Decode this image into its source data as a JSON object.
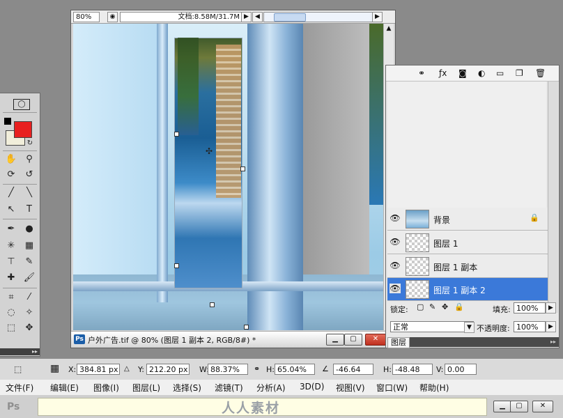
{
  "document": {
    "zoom": "80%",
    "doc_info": "文档:8.58M/31.7M",
    "title": "户外广告.tif @ 80% (图层 1 副本 2, RGB/8#) *",
    "ps_badge": "Ps"
  },
  "layers_panel": {
    "tab_label": "图层",
    "blend_mode": "正常",
    "opacity_label": "不透明度:",
    "opacity_value": "100%",
    "lock_label": "锁定:",
    "fill_label": "填充:",
    "fill_value": "100%",
    "layers": [
      {
        "name": "图层 1 副本 2",
        "active": true,
        "type": "transparent"
      },
      {
        "name": "图层 1 副本",
        "active": false,
        "type": "transparent"
      },
      {
        "name": "图层 1",
        "active": false,
        "type": "transparent"
      },
      {
        "name": "背景",
        "active": false,
        "type": "background",
        "locked": true
      }
    ]
  },
  "options_bar": {
    "x_label": "X:",
    "x_value": "384.81 px",
    "y_label": "Y:",
    "y_value": "212.20 px",
    "w_label": "W:",
    "w_value": "88.37%",
    "h_label": "H:",
    "h_value": "65.04%",
    "angle_value": "-46.64",
    "h_skew_label": "H:",
    "h_skew_value": "-48.48",
    "v_skew_label": "V:",
    "v_skew_value": "0.00"
  },
  "menu": [
    "文件(F)",
    "编辑(E)",
    "图像(I)",
    "图层(L)",
    "选择(S)",
    "滤镜(T)",
    "分析(A)",
    "3D(D)",
    "视图(V)",
    "窗口(W)",
    "帮助(H)"
  ],
  "app_bar": {
    "logo": "Ps",
    "watermark": "人人素材"
  },
  "colors": {
    "foreground": "#e82020",
    "background": "#f1eedb",
    "accent": "#3b79d9"
  },
  "tools": [
    "rectangular-marquee",
    "move",
    "lasso",
    "quick-selection",
    "crop",
    "slice",
    "eyedropper",
    "ruler",
    "healing-brush",
    "brush",
    "clone-stamp",
    "history-brush",
    "eraser",
    "gradient",
    "blur",
    "dodge",
    "pen",
    "type",
    "path-selection",
    "shape",
    "3d-rotate",
    "3d-orbit",
    "hand",
    "zoom",
    "quick-mask"
  ]
}
